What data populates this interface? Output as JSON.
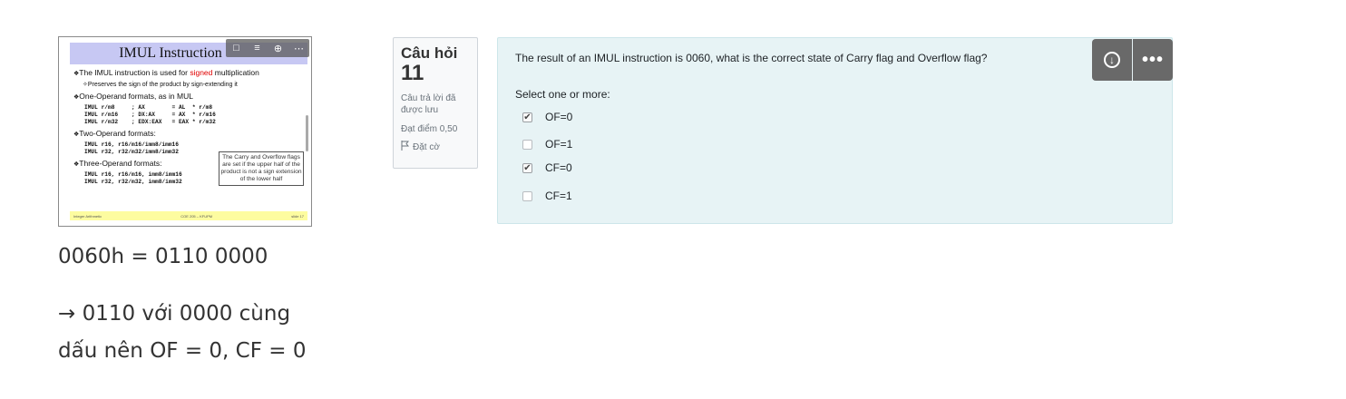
{
  "slide": {
    "title": "IMUL Instruction",
    "toolbar_icons": [
      "comment-icon",
      "menu-icon",
      "download-icon",
      "more-icon"
    ],
    "bullet1_pre": "The IMUL instruction is used for ",
    "bullet1_red": "signed",
    "bullet1_post": " multiplication",
    "sub1": "Preserves the sign of the product by sign-extending it",
    "bullet2": "One-Operand formats, as in MUL",
    "code1": "IMUL r/m8     ; AX        = AL  * r/m8\nIMUL r/m16    ; DX:AX     = AX  * r/m16\nIMUL r/m32    ; EDX:EAX   = EAX * r/m32",
    "bullet3": "Two-Operand formats:",
    "code2": "IMUL r16, r16/m16/imm8/imm16\nIMUL r32, r32/m32/imm8/imm32",
    "bullet4": "Three-Operand formats:",
    "code3": "IMUL r16, r16/m16, imm8/imm16\nIMUL r32, r32/m32, imm8/imm32",
    "note": "The Carry and Overflow flags are set if the upper half of the product is not a sign extension of the lower half",
    "footer_left": "Integer Arithmetic",
    "footer_mid": "COE 205 – KFUPM",
    "footer_right": "slide 17"
  },
  "notes": {
    "line1": "0060h = 0110 0000",
    "line2": "→ 0110 với 0000 cùng dấu nên OF = 0, CF = 0"
  },
  "question_info": {
    "label": "Câu hỏi",
    "number": "11",
    "status": "Câu trả lời đã được lưu",
    "grade": "Đạt điểm 0,50",
    "flag": "Đặt cờ"
  },
  "question": {
    "text": "The result of an IMUL instruction is 0060, what is the correct state of Carry flag and Overflow flag?",
    "prompt": "Select one or more:",
    "options": [
      {
        "label": "OF=0",
        "checked": true
      },
      {
        "label": "OF=1",
        "checked": false
      },
      {
        "label": "CF=0",
        "checked": true
      },
      {
        "label": "CF=1",
        "checked": false
      }
    ]
  }
}
